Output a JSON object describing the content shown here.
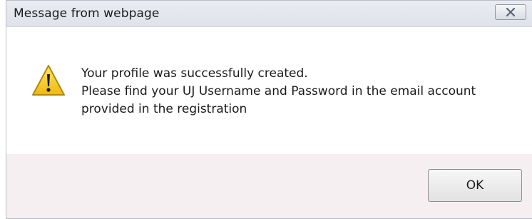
{
  "dialog": {
    "title": "Message from webpage",
    "close_icon": "close-icon",
    "warning_icon": "warning-triangle-icon",
    "message_lines": [
      "Your profile was successfully created.",
      "Please find your UJ Username and Password in the email account",
      "provided in the registration"
    ],
    "ok_label": "OK",
    "colors": {
      "titlebar": "#e5e9ee",
      "content": "#ffffff",
      "footer": "#f5eff2",
      "warning_yellow": "#f3c81c"
    }
  }
}
